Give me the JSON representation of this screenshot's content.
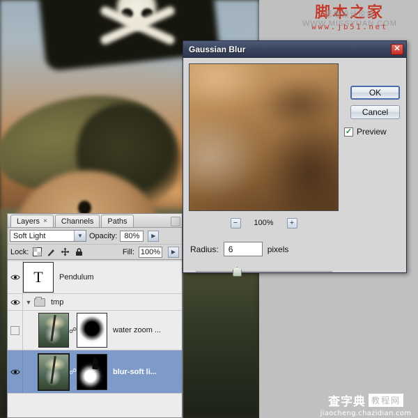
{
  "app": {
    "background_description": "blurred photo of a toy pirate figure with skull-and-crossbones flag"
  },
  "watermark_top": {
    "ghost_text": "思缘设计论坛 WWW.MISSYUAN.COM",
    "brand_cn": "脚本之家",
    "url": "www.jb51.net"
  },
  "watermark_bottom": {
    "brand_cn_1": "查字典",
    "brand_cn_2": "教程网",
    "url": "jiaocheng.chazidian.com"
  },
  "layers_panel": {
    "tabs": [
      {
        "label": "Layers",
        "close": "×",
        "active": true
      },
      {
        "label": "Channels",
        "active": false
      },
      {
        "label": "Paths",
        "active": false
      }
    ],
    "blend_mode": "Soft Light",
    "opacity_label": "Opacity:",
    "opacity_value": "80%",
    "lock_label": "Lock:",
    "lock_icons": [
      "transparency-lock-icon",
      "brush-lock-icon",
      "move-lock-icon",
      "lock-all-icon"
    ],
    "fill_label": "Fill:",
    "fill_value": "100%",
    "layers": [
      {
        "name": "Pendulum",
        "type": "text",
        "thumb_glyph": "T",
        "visible": true,
        "selected": false
      },
      {
        "name": "tmp",
        "type": "group",
        "visible": true,
        "expanded": true,
        "selected": false
      },
      {
        "name": "water zoom ...",
        "type": "image",
        "visible": false,
        "selected": false,
        "has_mask": true,
        "linked": true
      },
      {
        "name": "blur-soft li...",
        "type": "image",
        "visible": true,
        "selected": true,
        "has_mask": true,
        "linked": true
      }
    ]
  },
  "dialog": {
    "title": "Gaussian Blur",
    "close_label": "✕",
    "ok_label": "OK",
    "cancel_label": "Cancel",
    "preview_label": "Preview",
    "preview_checked": true,
    "check_glyph": "✓",
    "zoom_out_label": "−",
    "zoom_in_label": "+",
    "zoom_value": "100%",
    "radius_label": "Radius:",
    "radius_value": "6",
    "radius_units": "pixels",
    "slider_percent": 27
  },
  "colors": {
    "title_bar": "#3c465f",
    "close_button": "#c62a22",
    "selected_layer": "#7d9ac8",
    "panel_bg": "#d6d6d6",
    "canvas_bg": "#c0c0c0",
    "watermark_red": "#c0392b",
    "check_green": "#2e8b2e"
  }
}
